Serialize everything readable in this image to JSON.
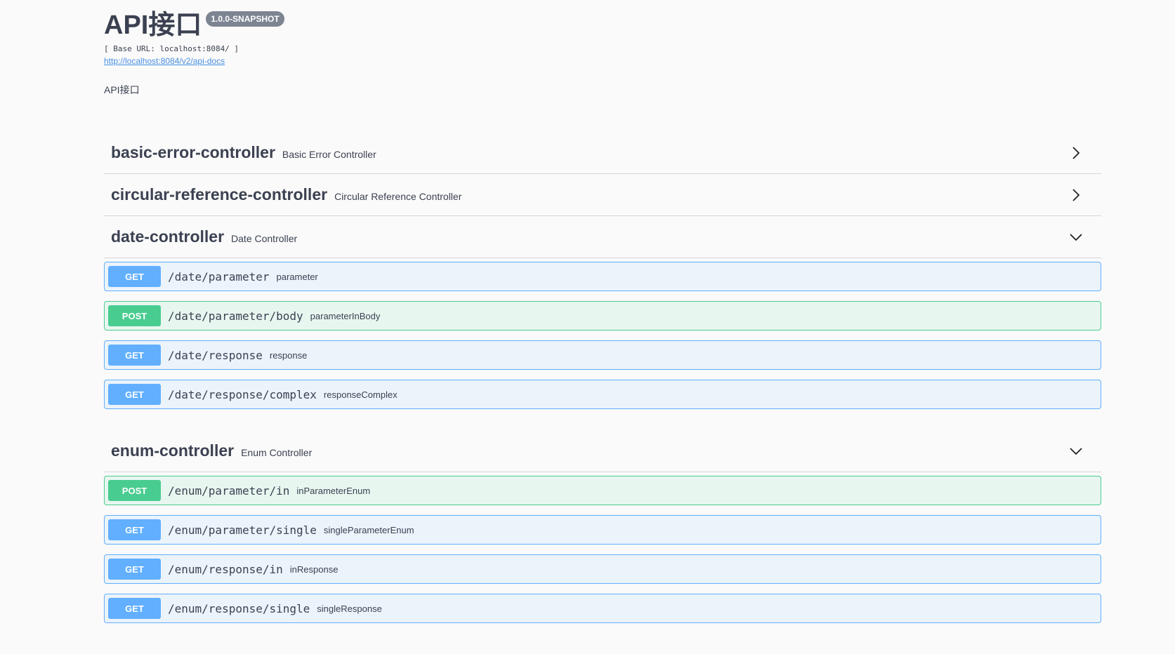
{
  "info": {
    "title": "API接口",
    "version": "1.0.0-SNAPSHOT",
    "base_url": "[ Base URL: localhost:8084/ ]",
    "docs_link": "http://localhost:8084/v2/api-docs",
    "description": "API接口"
  },
  "icons": {
    "collapsed": "chevron-right-icon",
    "expanded": "chevron-down-icon"
  },
  "colors": {
    "get": "#61affe",
    "post": "#49cc90",
    "get_bg": "#ebf3fb",
    "post_bg": "#e8f6f0"
  },
  "tags": [
    {
      "name": "basic-error-controller",
      "description": "Basic Error Controller",
      "expanded": false,
      "operations": []
    },
    {
      "name": "circular-reference-controller",
      "description": "Circular Reference Controller",
      "expanded": false,
      "operations": []
    },
    {
      "name": "date-controller",
      "description": "Date Controller",
      "expanded": true,
      "operations": [
        {
          "method": "GET",
          "path": "/date/parameter",
          "summary": "parameter"
        },
        {
          "method": "POST",
          "path": "/date/parameter/body",
          "summary": "parameterInBody"
        },
        {
          "method": "GET",
          "path": "/date/response",
          "summary": "response"
        },
        {
          "method": "GET",
          "path": "/date/response/complex",
          "summary": "responseComplex"
        }
      ]
    },
    {
      "name": "enum-controller",
      "description": "Enum Controller",
      "expanded": true,
      "operations": [
        {
          "method": "POST",
          "path": "/enum/parameter/in",
          "summary": "inParameterEnum"
        },
        {
          "method": "GET",
          "path": "/enum/parameter/single",
          "summary": "singleParameterEnum"
        },
        {
          "method": "GET",
          "path": "/enum/response/in",
          "summary": "inResponse"
        },
        {
          "method": "GET",
          "path": "/enum/response/single",
          "summary": "singleResponse"
        }
      ]
    }
  ]
}
